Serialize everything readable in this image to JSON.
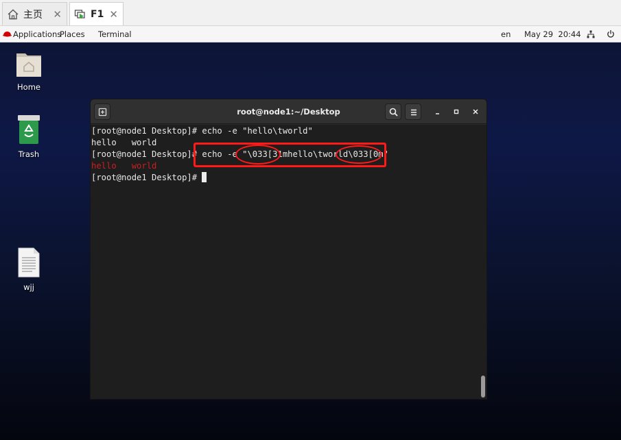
{
  "vm_tabs": [
    {
      "label": "主页",
      "close": "✕"
    },
    {
      "label": "F1",
      "close": "✕"
    }
  ],
  "topbar": {
    "applications": "Applications",
    "places": "Places",
    "terminal": "Terminal",
    "lang": "en",
    "datetime": "May 29  20:44"
  },
  "desktop_icons": [
    {
      "label": "Home",
      "icon": "home-folder-icon"
    },
    {
      "label": "Trash",
      "icon": "trash-icon"
    },
    {
      "label": "wjj",
      "icon": "text-file-icon"
    }
  ],
  "terminal": {
    "title": "root@node1:~/Desktop",
    "lines": [
      {
        "text": "[root@node1 Desktop]# echo -e \"hello\\tworld\""
      },
      {
        "text": "hello   world"
      },
      {
        "text": "[root@node1 Desktop]# echo -e \"\\033[31mhello\\tworld\\033[0m\""
      },
      {
        "text": "hello   world",
        "color": "#cc1e1e"
      },
      {
        "text": "[root@node1 Desktop]# "
      }
    ]
  },
  "colors": {
    "annotation": "#ff1a1a",
    "red_output": "#cc1e1e",
    "terminal_bg": "#1e1e1e"
  }
}
